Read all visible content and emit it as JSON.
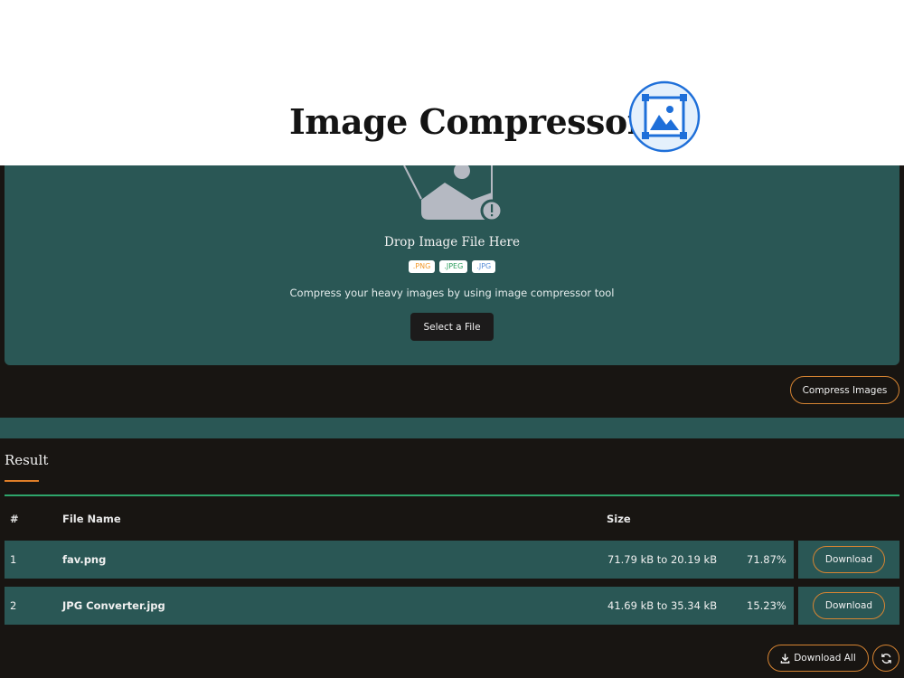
{
  "header": {
    "title": "Image Compressor",
    "logo_icon": "image-frame-icon",
    "logo_color": "#1e6fd9"
  },
  "dropzone": {
    "illustration_icon": "image-upload-illustration",
    "title": "Drop Image File Here",
    "formats": [
      ".PNG",
      ".JPEG",
      ".JPG"
    ],
    "description": "Compress your heavy images by using image compressor tool",
    "select_button": "Select a File"
  },
  "actions": {
    "compress_button": "Compress Images"
  },
  "result": {
    "title": "Result",
    "columns": {
      "num": "#",
      "name": "File Name",
      "size": "Size"
    },
    "rows": [
      {
        "num": "1",
        "name": "fav.png",
        "size": "71.79 kB to 20.19 kB",
        "percent": "71.87%",
        "download": "Download"
      },
      {
        "num": "2",
        "name": "JPG Converter.jpg",
        "size": "41.69 kB to 35.34 kB",
        "percent": "15.23%",
        "download": "Download"
      }
    ],
    "download_all": "Download All",
    "download_all_icon": "download-icon",
    "reset_icon": "refresh-icon"
  },
  "colors": {
    "accent": "#d68432",
    "panel": "#2a5755",
    "background": "#181512",
    "success_line": "#2ea56b"
  }
}
